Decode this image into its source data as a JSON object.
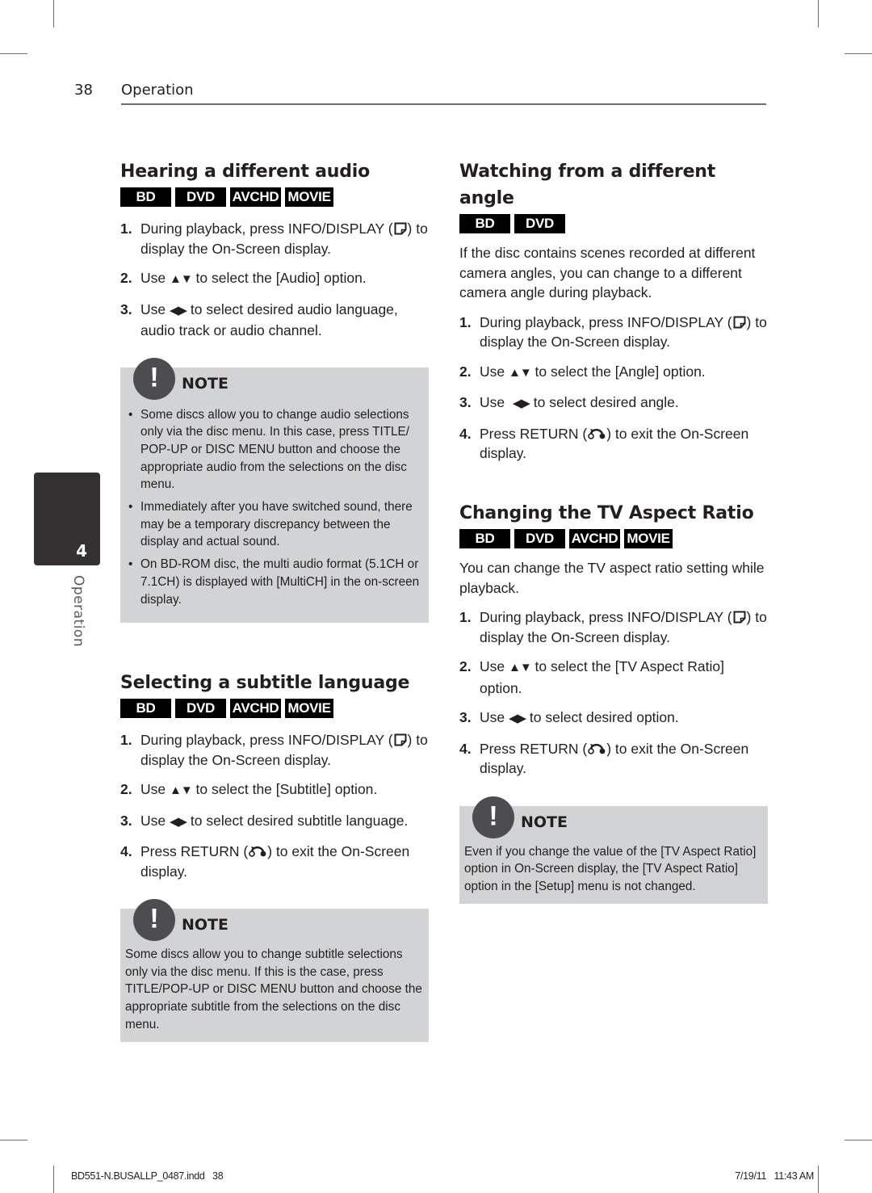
{
  "header": {
    "page_number": "38",
    "section": "Operation"
  },
  "side_tab": {
    "chapter_number": "4",
    "label": "Operation"
  },
  "icons": {
    "info_display": "info-display-icon",
    "return": "return-icon",
    "up_down": "▲▼",
    "left_right": "◀▶",
    "note": "!"
  },
  "sections": {
    "audio": {
      "title": "Hearing a different audio",
      "badges": [
        "BD",
        "DVD",
        "AVCHD",
        "MOVIE"
      ],
      "steps": [
        {
          "num": "1.",
          "pre": "During playback, press INFO/DISPLAY (",
          "post": ") to display the On-Screen display."
        },
        {
          "num": "2.",
          "pre": "Use ",
          "post": " to select the [Audio] option."
        },
        {
          "num": "3.",
          "pre": "Use ",
          "post": " to select desired audio language, audio track or audio channel."
        }
      ],
      "note": {
        "title": "NOTE",
        "bullets": [
          "Some discs allow you to change audio selections only via the disc menu. In this case, press TITLE/ POP-UP or DISC MENU button and choose the appropriate audio from the selections on the disc menu.",
          "Immediately after you have switched sound, there may be a temporary discrepancy between the display and actual sound.",
          "On BD-ROM disc, the multi audio format (5.1CH or 7.1CH) is displayed with [MultiCH] in the on-screen display."
        ]
      }
    },
    "subtitle": {
      "title": "Selecting a subtitle language",
      "badges": [
        "BD",
        "DVD",
        "AVCHD",
        "MOVIE"
      ],
      "steps": [
        {
          "num": "1.",
          "pre": "During playback, press INFO/DISPLAY (",
          "post": ") to display the On-Screen display."
        },
        {
          "num": "2.",
          "pre": "Use ",
          "post": " to select the [Subtitle] option."
        },
        {
          "num": "3.",
          "pre": "Use ",
          "post": " to select desired subtitle language."
        },
        {
          "num": "4.",
          "pre": "Press RETURN (",
          "post": ") to exit the On-Screen display."
        }
      ],
      "note": {
        "title": "NOTE",
        "text": "Some discs allow you to change subtitle selections only via the disc menu. If this is the case, press TITLE/POP-UP or DISC MENU button and choose the appropriate subtitle from the selections on the disc menu."
      }
    },
    "angle": {
      "title": "Watching from a different angle",
      "badges": [
        "BD",
        "DVD"
      ],
      "intro": "If the disc contains scenes recorded at different camera angles, you can change to a different camera angle during playback.",
      "steps": [
        {
          "num": "1.",
          "pre": "During playback, press INFO/DISPLAY (",
          "post": ") to display the On-Screen display."
        },
        {
          "num": "2.",
          "pre": "Use ",
          "post": " to select the [Angle] option."
        },
        {
          "num": "3.",
          "pre": "Use  ",
          "post": " to select desired angle."
        },
        {
          "num": "4.",
          "pre": "Press RETURN (",
          "post": ") to exit the On-Screen display."
        }
      ]
    },
    "aspect": {
      "title": "Changing the TV Aspect Ratio",
      "badges": [
        "BD",
        "DVD",
        "AVCHD",
        "MOVIE"
      ],
      "intro": "You can change the TV aspect ratio setting while playback.",
      "steps": [
        {
          "num": "1.",
          "pre": "During playback, press INFO/DISPLAY (",
          "post": ") to display the On-Screen display."
        },
        {
          "num": "2.",
          "pre": "Use ",
          "post": " to select the [TV Aspect Ratio] option."
        },
        {
          "num": "3.",
          "pre": "Use ",
          "post": " to select desired option."
        },
        {
          "num": "4.",
          "pre": "Press RETURN (",
          "post": ") to exit the On-Screen display."
        }
      ],
      "note": {
        "title": "NOTE",
        "text": "Even if you change the value of the [TV Aspect Ratio] option in On-Screen display, the [TV Aspect Ratio] option in the [Setup] menu is not changed."
      }
    }
  },
  "footer": {
    "file": "BD551-N.BUSALLP_0487.indd   38",
    "timestamp": "7/19/11   11:43 AM"
  }
}
